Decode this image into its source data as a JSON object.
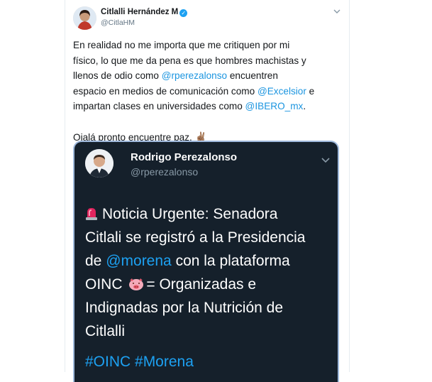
{
  "tweet": {
    "author_name": "Citlalli Hernández M",
    "author_handle": "@CitlaHM",
    "verified": true,
    "lines": [
      "En realidad no me importa que me critiquen por mi",
      "físico, lo que me da pena es que hombres machistas y",
      "llenos de odio como ",
      " encuentren",
      "espacio en medios de comunicación como ",
      " e",
      "impartan clases en universidades como ",
      "."
    ],
    "mentions": {
      "rperezalonso": "@rperezalonso",
      "excelsior": "@Excelsior",
      "ibero": "@IBERO_mx"
    },
    "sign_off": "Ojalá pronto encuentre paz.",
    "sign_off_emoji": "✌🏽"
  },
  "embedded_tweet": {
    "author_name": "Rodrigo Perezalonso",
    "author_handle": "@rperezalonso",
    "line1": "Noticia Urgente: Senadora",
    "line2": "Citlali se registró a la Presidencia",
    "line3_pre": "de ",
    "line3_mention": "@morena",
    "line3_post": " con la plataforma",
    "line4_pre": "OINC",
    "line4_post": "= Organizadas e",
    "line5": "Indignadas por la Nutrición de",
    "line6": "Citlalli",
    "hashtags": "#OINC #Morena"
  },
  "colors": {
    "link": "#1b95e0",
    "embed_bg": "#15202b",
    "verified": "#1da1f2"
  },
  "icons": [
    "avatar",
    "verified-badge-icon",
    "chevron-down-icon",
    "peace-hand-emoji",
    "siren-emoji",
    "pig-face-emoji"
  ]
}
